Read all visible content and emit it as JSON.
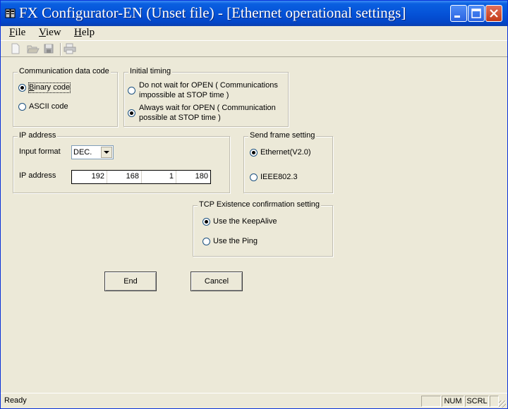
{
  "window": {
    "title": "FX Configurator-EN (Unset file) - [Ethernet operational settings]"
  },
  "menu": {
    "file": {
      "accel": "F",
      "rest": "ile"
    },
    "view": {
      "accel": "V",
      "rest": "iew"
    },
    "help": {
      "accel": "H",
      "rest": "elp"
    }
  },
  "toolbar": {
    "icons": [
      "new-file-icon",
      "open-folder-icon",
      "save-icon",
      "print-icon"
    ]
  },
  "communication_data_code": {
    "title": "Communication data code",
    "options": [
      {
        "label": "Binary code",
        "accel": "B",
        "checked": true
      },
      {
        "label": "ASCII code",
        "checked": false
      }
    ]
  },
  "initial_timing": {
    "title": "Initial timing",
    "options": [
      {
        "line1": "Do not wait for OPEN ( Communications",
        "line2": "impossible at STOP time )",
        "checked": false
      },
      {
        "line1": "Always wait for OPEN ( Communication",
        "line2": "possible at STOP time )",
        "checked": true
      }
    ]
  },
  "ip_address": {
    "title": "IP address",
    "input_format_label": "Input format",
    "input_format_value": "DEC.",
    "address_label": "IP address",
    "octets": [
      "192",
      "168",
      "1",
      "180"
    ]
  },
  "send_frame": {
    "title": "Send frame setting",
    "options": [
      {
        "label": "Ethernet(V2.0)",
        "checked": true
      },
      {
        "label": "IEEE802.3",
        "checked": false
      }
    ]
  },
  "tcp_existence": {
    "title": "TCP Existence confirmation setting",
    "options": [
      {
        "label": "Use the KeepAlive",
        "checked": true
      },
      {
        "label": "Use the Ping",
        "checked": false
      }
    ]
  },
  "buttons": {
    "end": "End",
    "cancel": "Cancel"
  },
  "status": {
    "text": "Ready",
    "num": "NUM",
    "scrl": "SCRL"
  },
  "colors": {
    "title_bar": "#0553d8",
    "window_bg": "#ece9d8",
    "close_button": "#c33a17"
  }
}
